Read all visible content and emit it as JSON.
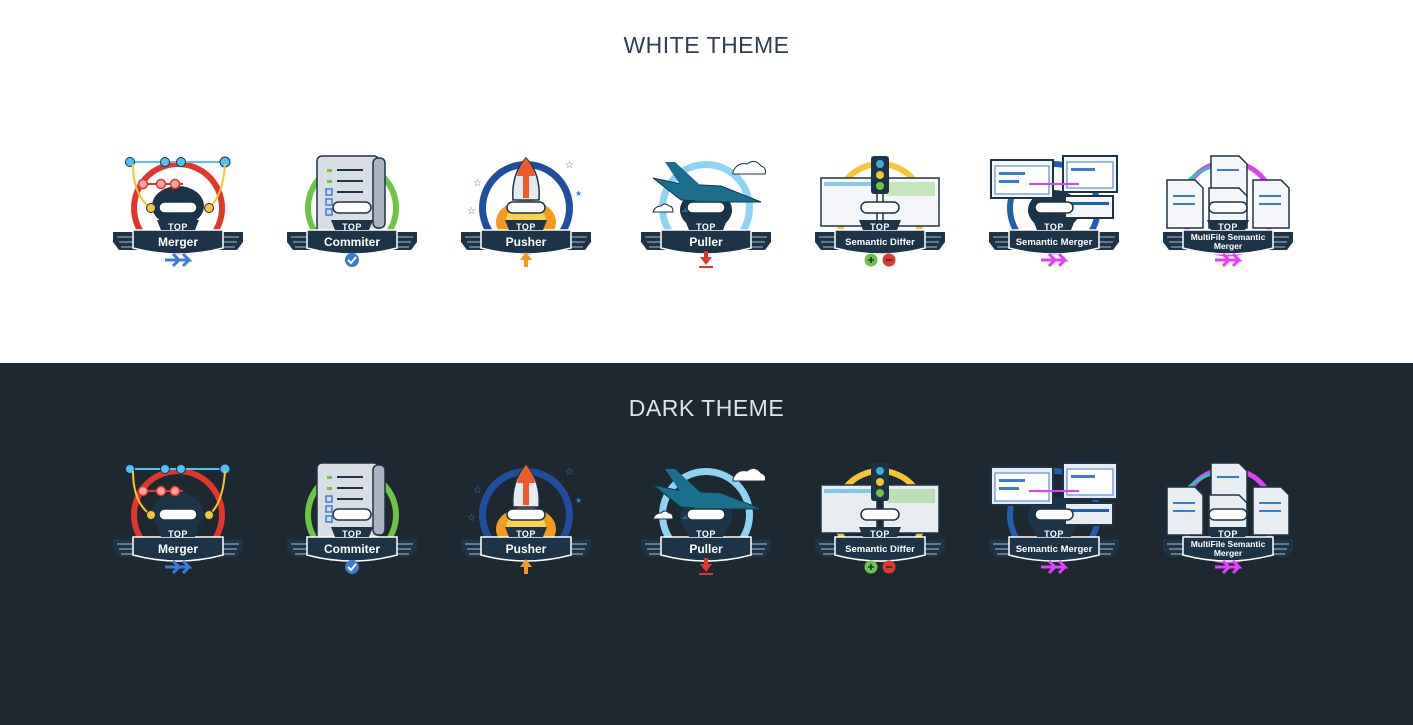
{
  "sections": {
    "white": {
      "title": "WHITE THEME",
      "badges": [
        {
          "top": "TOP",
          "name": "Merger",
          "icon": "merge-graph-icon",
          "colors": [
            "#e0362c",
            "#4fc3f7",
            "#f7c531",
            "#3aaee0"
          ],
          "bottom_icon": "double-arrow-icon"
        },
        {
          "top": "TOP",
          "name": "Commiter",
          "icon": "checklist-scroll-icon",
          "colors": [
            "#6cc644",
            "#3a7bd5"
          ],
          "bottom_icon": "check-circle-icon"
        },
        {
          "top": "TOP",
          "name": "Pusher",
          "icon": "rocket-icon",
          "colors": [
            "#1f4e9e",
            "#f29b1d",
            "#f05a28"
          ],
          "bottom_icon": "up-arrow-icon"
        },
        {
          "top": "TOP",
          "name": "Puller",
          "icon": "jet-plane-icon",
          "colors": [
            "#8fd3f4",
            "#1a6f8f",
            "#e0362c"
          ],
          "bottom_icon": "down-arrow-icon"
        },
        {
          "top": "TOP",
          "name": "Semantic Differ",
          "icon": "traffic-light-icon",
          "colors": [
            "#f7c531",
            "#3aaee0",
            "#6cc644",
            "#e0362c"
          ],
          "bottom_icon": "plus-minus-icon"
        },
        {
          "top": "TOP",
          "name": "Semantic Merger",
          "icon": "code-windows-icon",
          "colors": [
            "#1f5fae",
            "#e040fb"
          ],
          "bottom_icon": "double-arrow-icon"
        },
        {
          "top": "TOP",
          "name": "MultiFile Semantic Merger",
          "icon": "documents-icon",
          "colors": [
            "#e040fb",
            "#2ec4b6"
          ],
          "bottom_icon": "double-arrow-icon"
        }
      ]
    },
    "dark": {
      "title": "DARK THEME",
      "badges": [
        {
          "top": "TOP",
          "name": "Merger",
          "icon": "merge-graph-icon",
          "colors": [
            "#e0362c",
            "#4fc3f7",
            "#f7c531",
            "#3aaee0"
          ],
          "bottom_icon": "double-arrow-icon"
        },
        {
          "top": "TOP",
          "name": "Commiter",
          "icon": "checklist-scroll-icon",
          "colors": [
            "#6cc644",
            "#3a7bd5"
          ],
          "bottom_icon": "check-circle-icon"
        },
        {
          "top": "TOP",
          "name": "Pusher",
          "icon": "rocket-icon",
          "colors": [
            "#1f4e9e",
            "#f29b1d",
            "#f05a28"
          ],
          "bottom_icon": "up-arrow-icon"
        },
        {
          "top": "TOP",
          "name": "Puller",
          "icon": "jet-plane-icon",
          "colors": [
            "#8fd3f4",
            "#1a6f8f",
            "#e0362c"
          ],
          "bottom_icon": "down-arrow-icon"
        },
        {
          "top": "TOP",
          "name": "Semantic Differ",
          "icon": "traffic-light-icon",
          "colors": [
            "#f7c531",
            "#3aaee0",
            "#6cc644",
            "#e0362c"
          ],
          "bottom_icon": "plus-minus-icon"
        },
        {
          "top": "TOP",
          "name": "Semantic Merger",
          "icon": "code-windows-icon",
          "colors": [
            "#1f5fae",
            "#e040fb"
          ],
          "bottom_icon": "double-arrow-icon"
        },
        {
          "top": "TOP",
          "name": "MultiFile Semantic Merger",
          "icon": "documents-icon",
          "colors": [
            "#e040fb",
            "#2ec4b6"
          ],
          "bottom_icon": "double-arrow-icon"
        }
      ]
    }
  },
  "theme_colors": {
    "white_bg": "#ffffff",
    "dark_bg": "#1e2830",
    "white_title": "#2f3f55",
    "dark_title": "#dde3e8",
    "banner": "#1d3347"
  }
}
